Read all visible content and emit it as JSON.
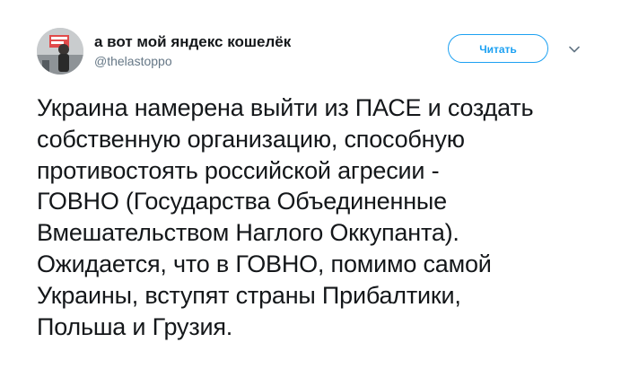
{
  "tweet": {
    "display_name": "а вот мой яндекс кошелёк",
    "handle": "@thelastoppo",
    "follow_label": "Читать",
    "caret_icon": "chevron-down-icon",
    "text": "Украина намерена выйти из ПАСЕ и создать\nсобственную организацию, способную\nпротивостоять российской агресии -\nГОВНО (Государства Объединенные\nВмешательством Наглого Оккупанта).\nОжидается, что в ГОВНО, помимо самой\nУкраины, вступят страны Прибалтики,\nПольша и Грузия.",
    "colors": {
      "accent": "#1da1f2",
      "text": "#14171a",
      "secondary": "#657786"
    }
  }
}
